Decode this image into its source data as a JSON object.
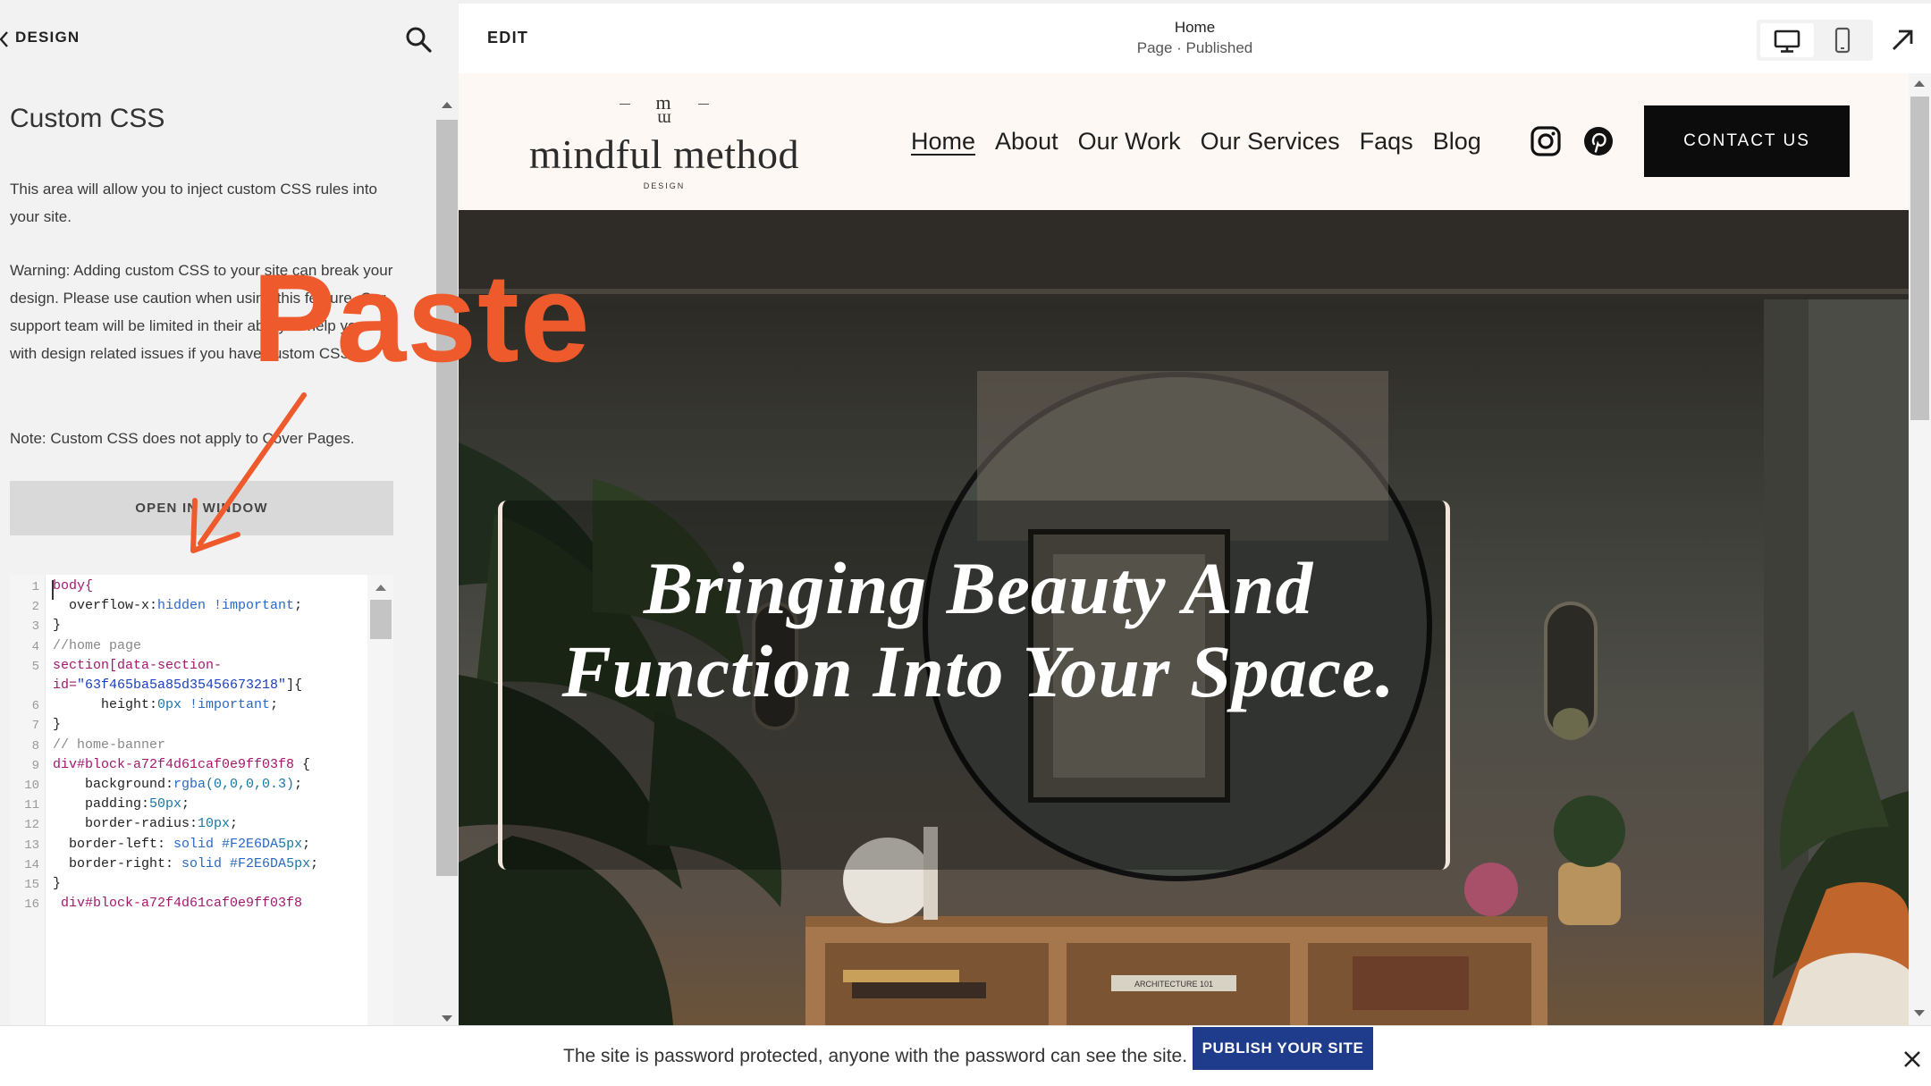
{
  "panel": {
    "back_label": "DESIGN",
    "title": "Custom CSS",
    "intro": "This area will allow you to inject custom CSS rules into your site.",
    "warning": "Warning: Adding custom CSS to your site can break your design. Please use caution when using this feature. Our support team will be limited in their ability to help you with design related issues if you have custom CSS.",
    "note": "Note: Custom CSS does not apply to Cover Pages.",
    "open_window_label": "OPEN IN WINDOW"
  },
  "editor": {
    "line_numbers": [
      "1",
      "2",
      "3",
      "4",
      "5",
      "6",
      "7",
      "8",
      "9",
      "10",
      "11",
      "12",
      "13",
      "14",
      "15",
      "16"
    ],
    "lines": [
      {
        "sel": "body{"
      },
      {
        "prop": "  overflow-x:",
        "val": "hidden",
        "imp": " !important",
        "end": ";"
      },
      {
        "end": "}"
      },
      {
        "com": "//home page"
      },
      {
        "sel": "section[data-section-"
      },
      {
        "sel": "id=",
        "str": "\"63f465ba5a85d35456673218\"",
        "end": "]{"
      },
      {
        "prop": "      height:",
        "num": "0px",
        "imp": " !important",
        "end": ";"
      },
      {
        "end": "}"
      },
      {
        "com": "// home-banner"
      },
      {
        "sel": "div#block-a72f4d61caf0e9ff03f8",
        "end": " {"
      },
      {
        "prop": "    background:",
        "val": "rgba",
        "num": "(0,0,0,0.3)",
        "end": ";"
      },
      {
        "prop": "    padding:",
        "num": "50px",
        "end": ";"
      },
      {
        "prop": "    border-radius:",
        "num": "10px",
        "end": ";"
      },
      {
        "prop": "  border-left:",
        "num": "5px",
        "val": " solid #F2E6DA",
        "end": ";"
      },
      {
        "prop": "  border-right:",
        "num": "5px",
        "val": " solid #F2E6DA",
        "end": ";"
      },
      {
        "end": "}"
      },
      {
        "sel": " div#block-a72f4d61caf0e9ff03f8"
      }
    ]
  },
  "annotation": {
    "text": "Paste",
    "color": "#ef5a2d"
  },
  "topbar": {
    "edit_label": "EDIT",
    "page_name": "Home",
    "page_status": "Page · Published"
  },
  "site": {
    "logo_mark": "m",
    "logo_mark_2": "ɯ",
    "logo_name": "mindful method",
    "logo_sub": "DESIGN",
    "nav": [
      {
        "label": "Home",
        "active": true
      },
      {
        "label": "About"
      },
      {
        "label": "Our Work"
      },
      {
        "label": "Our Services"
      },
      {
        "label": "Faqs"
      },
      {
        "label": "Blog"
      }
    ],
    "contact_label": "CONTACT US",
    "hero_heading": "Bringing Beauty And Function Into Your Space.",
    "book_spine_label": "ARCHITECTURE 101"
  },
  "banner": {
    "text": "The site is password protected, anyone with the password can see the site.",
    "publish_label": "PUBLISH YOUR SITE"
  },
  "colors": {
    "accent_orange": "#ef5a2d",
    "publish_blue": "#1e3b8c",
    "site_bg": "#fdf8f3",
    "hero_border": "#F2E6DA"
  }
}
